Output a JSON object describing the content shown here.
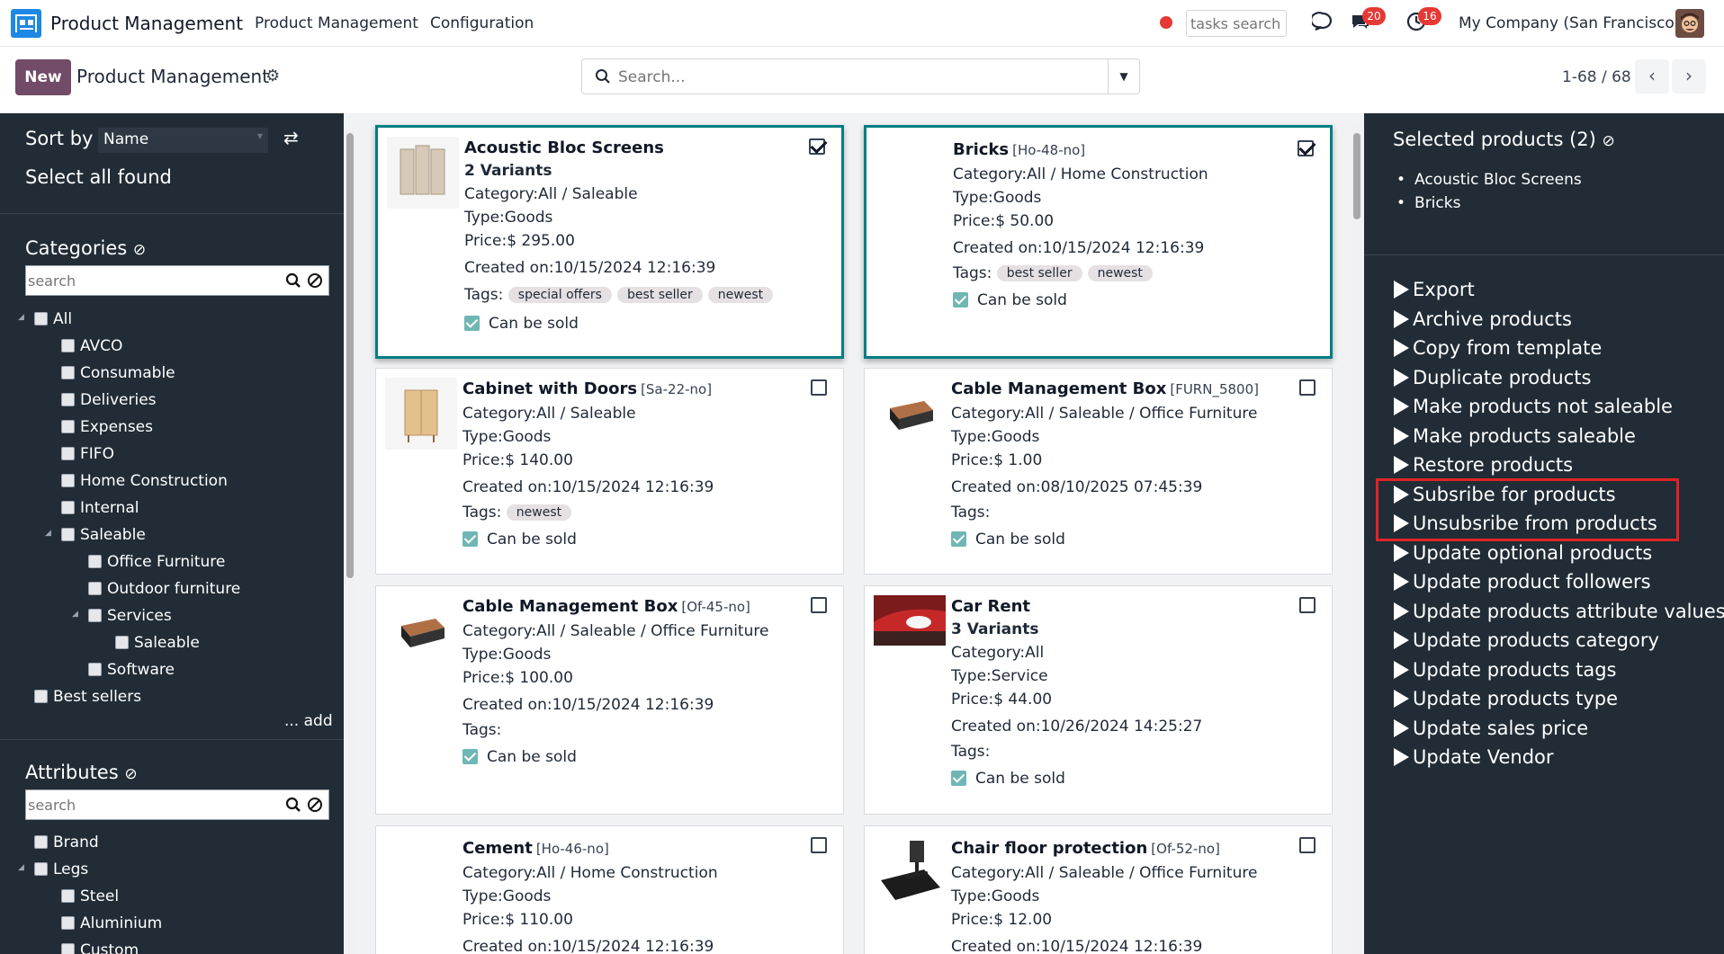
{
  "navbar": {
    "app_name": "Product Management",
    "menus": [
      "Product Management",
      "Configuration"
    ],
    "tasks_search_placeholder": "tasks search",
    "messages_badge": "20",
    "activities_badge": "16",
    "company": "My Company (San Francisco)"
  },
  "control_panel": {
    "new_label": "New",
    "title": "Product Management",
    "search_placeholder": "Search...",
    "pager": "1-68 / 68"
  },
  "left_panel": {
    "sort_by_label": "Sort by",
    "sort_value": "Name",
    "select_all_label": "Select all found",
    "categories_title": "Categories",
    "categories_search_placeholder": "search",
    "categories": [
      {
        "label": "All"
      },
      {
        "label": "AVCO"
      },
      {
        "label": "Consumable"
      },
      {
        "label": "Deliveries"
      },
      {
        "label": "Expenses"
      },
      {
        "label": "FIFO"
      },
      {
        "label": "Home Construction"
      },
      {
        "label": "Internal"
      },
      {
        "label": "Saleable"
      },
      {
        "label": "Office Furniture"
      },
      {
        "label": "Outdoor furniture"
      },
      {
        "label": "Services"
      },
      {
        "label": "Saleable"
      },
      {
        "label": "Software"
      },
      {
        "label": "Best sellers"
      }
    ],
    "add_label": "... add",
    "attributes_title": "Attributes",
    "attributes_search_placeholder": "search",
    "attributes": [
      {
        "label": "Brand"
      },
      {
        "label": "Legs"
      },
      {
        "label": "Steel"
      },
      {
        "label": "Aluminium"
      },
      {
        "label": "Custom"
      }
    ]
  },
  "labels": {
    "category": "Category:",
    "type": "Type:",
    "price": "Price:",
    "created": "Created on:",
    "tags": "Tags:",
    "can_be_sold": "Can be sold"
  },
  "cards": [
    {
      "name": "Acoustic Bloc Screens",
      "ref": "",
      "variants": "2 Variants",
      "category": "All / Saleable",
      "type": "Goods",
      "price": "$ 295.00",
      "created": "10/15/2024 12:16:39",
      "tags": [
        "special offers",
        "best seller",
        "newest"
      ],
      "selected": true
    },
    {
      "name": "Bricks",
      "ref": "[Ho-48-no]",
      "variants": "",
      "category": "All / Home Construction",
      "type": "Goods",
      "price": "$ 50.00",
      "created": "10/15/2024 12:16:39",
      "tags": [
        "best seller",
        "newest"
      ],
      "selected": true
    },
    {
      "name": "Cabinet with Doors",
      "ref": "[Sa-22-no]",
      "variants": "",
      "category": "All / Saleable",
      "type": "Goods",
      "price": "$ 140.00",
      "created": "10/15/2024 12:16:39",
      "tags": [
        "newest"
      ],
      "selected": false
    },
    {
      "name": "Cable Management Box",
      "ref": "[FURN_5800]",
      "variants": "",
      "category": "All / Saleable / Office Furniture",
      "type": "Goods",
      "price": "$ 1.00",
      "created": "08/10/2025 07:45:39",
      "tags": [],
      "selected": false
    },
    {
      "name": "Cable Management Box",
      "ref": "[Of-45-no]",
      "variants": "",
      "category": "All / Saleable / Office Furniture",
      "type": "Goods",
      "price": "$ 100.00",
      "created": "10/15/2024 12:16:39",
      "tags": [],
      "selected": false
    },
    {
      "name": "Car Rent",
      "ref": "",
      "variants": "3 Variants",
      "category": "All",
      "type": "Service",
      "price": "$ 44.00",
      "created": "10/26/2024 14:25:27",
      "tags": [],
      "selected": false
    },
    {
      "name": "Cement",
      "ref": "[Ho-46-no]",
      "variants": "",
      "category": "All / Home Construction",
      "type": "Goods",
      "price": "$ 110.00",
      "created": "10/15/2024 12:16:39",
      "tags": [],
      "selected": false
    },
    {
      "name": "Chair floor protection",
      "ref": "[Of-52-no]",
      "variants": "",
      "category": "All / Saleable / Office Furniture",
      "type": "Goods",
      "price": "$ 12.00",
      "created": "10/15/2024 12:16:39",
      "tags": [],
      "selected": false
    }
  ],
  "right_panel": {
    "selected_title": "Selected products (2)",
    "selected_items": [
      "Acoustic Bloc Screens",
      "Bricks"
    ],
    "actions": [
      "Export",
      "Archive products",
      "Copy from template",
      "Duplicate products",
      "Make products not saleable",
      "Make products saleable",
      "Restore products",
      "Subsribe for products",
      "Unsubsribe from products",
      "Update optional products",
      "Update product followers",
      "Update products attribute values",
      "Update products category",
      "Update products tags",
      "Update products type",
      "Update sales price",
      "Update Vendor"
    ]
  },
  "colors": {
    "brand": "#714b67",
    "panel_bg": "#212c36",
    "selected_border": "#017e84",
    "highlight": "#e02424",
    "badge": "#e53935"
  }
}
